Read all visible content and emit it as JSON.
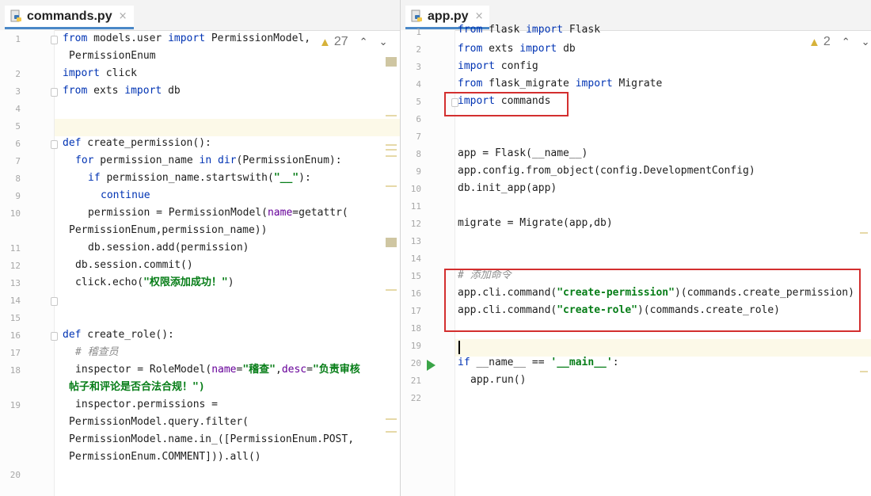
{
  "left": {
    "tab": {
      "title": "commands.py",
      "close": "×"
    },
    "warnings": {
      "count": "27",
      "up": "⌃",
      "down": "⌄"
    },
    "line_numbers": [
      "1",
      "2",
      "3",
      "4",
      "5",
      "6",
      "7",
      "8",
      "9",
      "10",
      "11",
      "12",
      "13",
      "14",
      "15",
      "16",
      "17",
      "18",
      "19",
      "20"
    ],
    "code": {
      "l1": [
        "from",
        " models.user ",
        "import",
        " PermissionModel,"
      ],
      "l1b": "PermissionEnum",
      "l2": [
        "import",
        " click"
      ],
      "l3": [
        "from",
        " exts ",
        "import",
        " db"
      ],
      "l6": [
        "def",
        " create_permission():"
      ],
      "l7": [
        "for",
        " permission_name ",
        "in",
        " ",
        "dir",
        "(PermissionEnum):"
      ],
      "l8": [
        "if",
        " permission_name.startswith(",
        "\"__\"",
        "):"
      ],
      "l9": "continue",
      "l10": [
        "permission = PermissionModel(",
        "name",
        "=getattr("
      ],
      "l10b": "PermissionEnum,permission_name))",
      "l11": "db.session.add(permission)",
      "l12": "db.session.commit()",
      "l13": [
        "click.echo(",
        "\"权限添加成功！\"",
        ")"
      ],
      "l16": [
        "def",
        " create_role():"
      ],
      "l17": "# 稽查员",
      "l18": [
        "inspector = RoleModel(",
        "name",
        "=",
        "\"稽查\"",
        ",",
        "desc",
        "=",
        "\"负责审核"
      ],
      "l18b": "帖子和评论是否合法合规！\")",
      "l19": "inspector.permissions =",
      "l19b": "PermissionModel.query.filter(",
      "l19c": "PermissionModel.name.in_([PermissionEnum.POST,",
      "l19d": "PermissionEnum.COMMENT])).all()"
    }
  },
  "right": {
    "tab": {
      "title": "app.py",
      "close": "×"
    },
    "warnings": {
      "count": "2",
      "up": "⌃",
      "down": "⌄"
    },
    "line_numbers": [
      "1",
      "2",
      "3",
      "4",
      "5",
      "6",
      "7",
      "8",
      "9",
      "10",
      "11",
      "12",
      "13",
      "14",
      "15",
      "16",
      "17",
      "18",
      "19",
      "20",
      "21",
      "22"
    ],
    "code": {
      "l1": [
        "from",
        " flask ",
        "import",
        " Flask"
      ],
      "l2": [
        "from",
        " exts ",
        "import",
        " db"
      ],
      "l3": [
        "import",
        " config"
      ],
      "l4": [
        "from",
        " flask_migrate ",
        "import",
        " Migrate"
      ],
      "l5": [
        "import",
        " commands"
      ],
      "l8": "app = Flask(__name__)",
      "l9": "app.config.from_object(config.DevelopmentConfig)",
      "l10": "db.init_app(app)",
      "l12": "migrate = Migrate(app,db)",
      "l15": "# 添加命令",
      "l16": [
        "app.cli.command(",
        "\"create-permission\"",
        ")(commands.create_permission)"
      ],
      "l17": [
        "app.cli.command(",
        "\"create-role\"",
        ")(commands.create_role)"
      ],
      "l20": [
        "if",
        " __name__ == ",
        "'__main__'",
        ":"
      ],
      "l21": "app.run()"
    }
  },
  "colors": {
    "keyword": "#0033b3",
    "string": "#067d17",
    "param": "#660099",
    "comment": "#8c8c8c",
    "highlight_box": "#d32f2f",
    "caret_line": "#fcf9e8"
  }
}
